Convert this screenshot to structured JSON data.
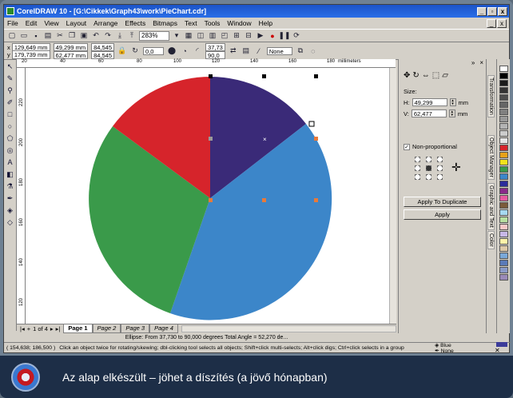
{
  "window": {
    "title": "CorelDRAW 10 - [G:\\Cikkek\\Graph43\\work\\PieChart.cdr]",
    "controls": [
      "_",
      "▫",
      "x"
    ]
  },
  "menu": [
    "File",
    "Edit",
    "View",
    "Layout",
    "Arrange",
    "Effects",
    "Bitmaps",
    "Text",
    "Tools",
    "Window",
    "Help"
  ],
  "toolbar": {
    "zoom": "283%"
  },
  "propbar": {
    "x": "129,649 mm",
    "y": "179,739 mm",
    "w": "49,299 mm",
    "h": "62,477 mm",
    "sx": "84,545",
    "sy": "84,545",
    "rotation": "0,0",
    "angle_start": "37,73",
    "angle_end": "90,0",
    "outline": "None"
  },
  "rulers": {
    "h_ticks": [
      "20",
      "40",
      "60",
      "80",
      "100",
      "120",
      "140",
      "160",
      "180"
    ],
    "h_unit": "millimeters",
    "v_ticks": [
      "220",
      "200",
      "180",
      "160",
      "140",
      "120"
    ],
    "v_unit": "millimeters"
  },
  "pie": {
    "colors": {
      "navy": "#3a2a78",
      "blue": "#3c86c9",
      "green": "#3a9a4a",
      "red": "#d6242b"
    }
  },
  "pages": {
    "counter": "1 of 4",
    "tabs": [
      "Page 1",
      "Page 2",
      "Page 3",
      "Page 4"
    ]
  },
  "status": {
    "object_info": "Ellipse: From 37,730 to 90,000 degrees  Total Angle = 52,270 de...",
    "coords": "( 154,638; 186,500 )",
    "hint": "Click an object twice for rotating/skewing; dbl-clicking tool selects all objects; Shift+click multi-selects; Alt+click digs; Ctrl+click selects in a group",
    "fill": "Blue",
    "outline": "None"
  },
  "docker": {
    "size_label": "Size:",
    "h_value": "49,299",
    "v_value": "62,477",
    "h_label": "H:",
    "v_label": "V:",
    "unit": "mm",
    "nonproportional": "Non-proportional",
    "apply_duplicate": "Apply To Duplicate",
    "apply": "Apply"
  },
  "side_tabs": [
    "Transformation",
    "Object Manager",
    "Graphic and Text",
    "Color"
  ],
  "palette": [
    "#ffffff",
    "#000000",
    "#1a1a1a",
    "#333333",
    "#4d4d4d",
    "#666666",
    "#808080",
    "#999999",
    "#b3b3b3",
    "#cccccc",
    "#e6e6e6",
    "#d6242b",
    "#e8a21a",
    "#f2e21a",
    "#3a9a4a",
    "#3c86c9",
    "#2b2b9a",
    "#8a2a8a",
    "#e85aa0",
    "#7a5a3a",
    "#a6d8f0",
    "#b8e0a0",
    "#f8c8c8",
    "#c8b8e8",
    "#fff2a8",
    "#dcc8a8",
    "#7aa8d8",
    "#5a7ab8",
    "#8a9ac8",
    "#9a8ab8"
  ],
  "caption": "Az alap elkészült – jöhet a díszítés (a jövő hónapban)"
}
